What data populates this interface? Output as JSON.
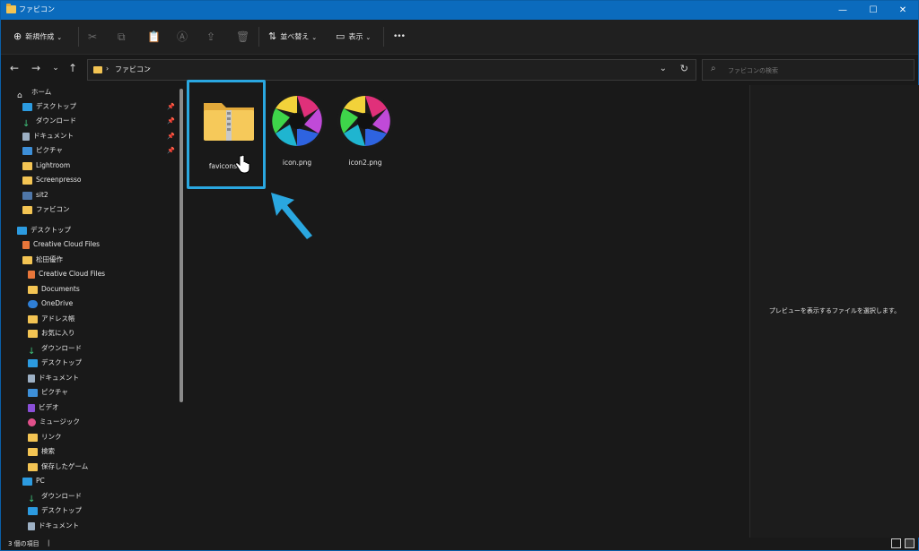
{
  "window": {
    "title": "ファビコン",
    "controls": {
      "minimize": "—",
      "maximize": "☐",
      "close": "✕"
    }
  },
  "toolbar": {
    "new_label": "新規作成",
    "sort_label": "並べ替え",
    "view_label": "表示",
    "more_label": "•••"
  },
  "address": {
    "breadcrumb": [
      "ファビコン"
    ],
    "search_placeholder": "ファビコンの検索"
  },
  "sidebar": {
    "home": "ホーム",
    "quick_access": [
      {
        "label": "デスクトップ",
        "icon": "desktop-icon",
        "pinned": true
      },
      {
        "label": "ダウンロード",
        "icon": "download-icon",
        "pinned": true
      },
      {
        "label": "ドキュメント",
        "icon": "document-icon",
        "pinned": true
      },
      {
        "label": "ピクチャ",
        "icon": "pictures-icon",
        "pinned": true
      },
      {
        "label": "Lightroom",
        "icon": "folder-icon",
        "pinned": false
      },
      {
        "label": "Screenpresso",
        "icon": "folder-icon",
        "pinned": false
      },
      {
        "label": "sit2",
        "icon": "image-icon",
        "pinned": false
      },
      {
        "label": "ファビコン",
        "icon": "folder-icon",
        "pinned": false
      }
    ],
    "desktop_section": "デスクトップ",
    "desktop_children": [
      {
        "label": "Creative Cloud Files",
        "icon": "creative-cloud-icon"
      },
      {
        "label": "松田優作",
        "icon": "folder-icon"
      }
    ],
    "user_children": [
      {
        "label": "Creative Cloud Files",
        "icon": "creative-cloud-icon"
      },
      {
        "label": "Documents",
        "icon": "folder-icon"
      },
      {
        "label": "OneDrive",
        "icon": "onedrive-icon"
      },
      {
        "label": "アドレス帳",
        "icon": "folder-icon"
      },
      {
        "label": "お気に入り",
        "icon": "folder-icon"
      },
      {
        "label": "ダウンロード",
        "icon": "download-icon"
      },
      {
        "label": "デスクトップ",
        "icon": "desktop-icon"
      },
      {
        "label": "ドキュメント",
        "icon": "document-icon"
      },
      {
        "label": "ピクチャ",
        "icon": "pictures-icon"
      },
      {
        "label": "ビデオ",
        "icon": "video-icon"
      },
      {
        "label": "ミュージック",
        "icon": "music-icon"
      },
      {
        "label": "リンク",
        "icon": "folder-icon"
      },
      {
        "label": "検索",
        "icon": "folder-icon"
      },
      {
        "label": "保存したゲーム",
        "icon": "folder-icon"
      }
    ],
    "pc_section": "PC",
    "pc_children": [
      {
        "label": "ダウンロード",
        "icon": "download-icon"
      },
      {
        "label": "デスクトップ",
        "icon": "desktop-icon"
      },
      {
        "label": "ドキュメント",
        "icon": "document-icon"
      }
    ]
  },
  "files": [
    {
      "name": "favicons.zip",
      "type": "zip-folder"
    },
    {
      "name": "icon.png",
      "type": "image"
    },
    {
      "name": "icon2.png",
      "type": "image"
    }
  ],
  "preview": {
    "message": "プレビューを表示するファイルを選択します。"
  },
  "status": {
    "item_count": "3 個の項目"
  },
  "colors": {
    "accent": "#0b6bbd",
    "highlight": "#2aa7e0",
    "folder": "#f3c453"
  }
}
